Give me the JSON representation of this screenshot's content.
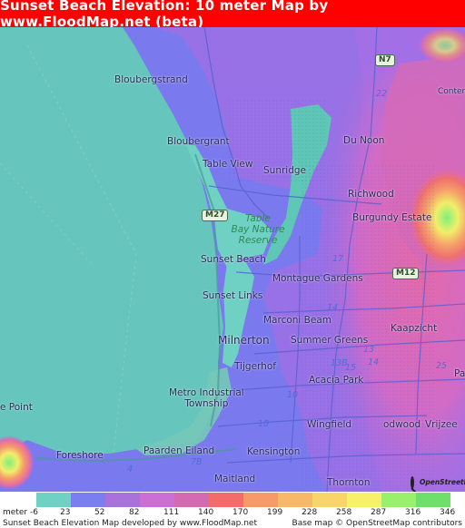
{
  "title": "Sunset Beach Elevation: 10 meter Map by www.FloodMap.net (beta)",
  "colors": {
    "title_bg": "#ff0000",
    "sea": "#66c6bd",
    "low_blue": "#7b79ee",
    "mid_violet": "#a46fe6",
    "high_pink": "#e76ba3"
  },
  "places": [
    {
      "label": "Bloubergstrand",
      "kind": "town"
    },
    {
      "label": "Bloubergrant",
      "kind": "town"
    },
    {
      "label": "Table View",
      "kind": "town"
    },
    {
      "label": "Sunridge",
      "kind": "town"
    },
    {
      "label": "Du Noon",
      "kind": "town"
    },
    {
      "label": "Richwood",
      "kind": "town"
    },
    {
      "label": "Burgundy Estate",
      "kind": "town"
    },
    {
      "label": "Table\nBay Nature\nReserve",
      "kind": "park"
    },
    {
      "label": "Sunset Beach",
      "kind": "town"
    },
    {
      "label": "Montague Gardens",
      "kind": "town"
    },
    {
      "label": "Sunset Links",
      "kind": "town"
    },
    {
      "label": "Milnerton",
      "kind": "town"
    },
    {
      "label": "Marconi Beam",
      "kind": "town"
    },
    {
      "label": "Kaapzicht",
      "kind": "town"
    },
    {
      "label": "Summer Greens",
      "kind": "town"
    },
    {
      "label": "Tijgerhof",
      "kind": "town"
    },
    {
      "label": "Acacia Park",
      "kind": "town"
    },
    {
      "label": "Metro Industrial\nTownship",
      "kind": "town"
    },
    {
      "label": "Wingfield",
      "kind": "town"
    },
    {
      "label": "odwood",
      "kind": "town"
    },
    {
      "label": "Vrijzee",
      "kind": "town"
    },
    {
      "label": "Paarden Eiland",
      "kind": "town"
    },
    {
      "label": "Kensington",
      "kind": "town"
    },
    {
      "label": "Foreshore",
      "kind": "town"
    },
    {
      "label": "Maitland",
      "kind": "town"
    },
    {
      "label": "Thornton",
      "kind": "town"
    },
    {
      "label": "e Point",
      "kind": "town"
    },
    {
      "label": "Conterma",
      "kind": "town"
    },
    {
      "label": "Pa",
      "kind": "town"
    }
  ],
  "roads": {
    "shields": [
      "N7",
      "M27",
      "M12"
    ],
    "numbers": [
      "22",
      "17",
      "14",
      "13",
      "13B",
      "15",
      "14",
      "10",
      "25",
      "7B",
      "4",
      "10"
    ]
  },
  "attribution_logo": "OpenStreetMap",
  "legend": {
    "unit_label": "meter",
    "start_value": "-6",
    "values": [
      "23",
      "52",
      "82",
      "111",
      "140",
      "170",
      "199",
      "228",
      "258",
      "287",
      "316",
      "346"
    ],
    "colors": [
      "#6fd0c4",
      "#7b7ef0",
      "#a871dc",
      "#cc6fd4",
      "#d46ab0",
      "#f46b6b",
      "#f79a68",
      "#f7b868",
      "#f7d568",
      "#f7f06a",
      "#99f06a",
      "#6ee06a"
    ],
    "footer_left": "Sunset Beach Elevation Map developed by www.FloodMap.net",
    "footer_right": "Base map © OpenStreetMap contributors"
  }
}
